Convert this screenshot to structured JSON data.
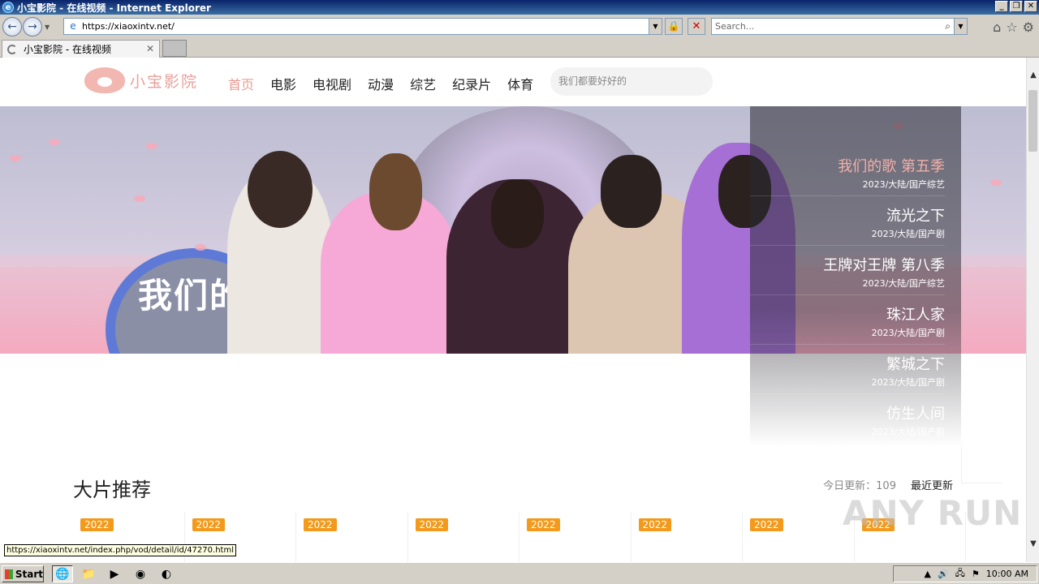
{
  "window": {
    "title": "小宝影院 - 在线视频 - Internet Explorer",
    "minimize": "_",
    "restore": "❐",
    "close": "✕"
  },
  "browser": {
    "address": "https://xiaoxintv.net/",
    "search_placeholder": "Search...",
    "tab_title": "小宝影院 - 在线视频",
    "tab_close": "✕",
    "status_link": "https://xiaoxintv.net/index.php/vod/detail/id/47270.html"
  },
  "site": {
    "logo_text": "小宝影院",
    "nav": [
      "首页",
      "电影",
      "电视剧",
      "动漫",
      "综艺",
      "纪录片",
      "体育"
    ],
    "search_placeholder": "我们都要好好的",
    "banner_emblem_text": "我们的"
  },
  "side_list": [
    {
      "title": "我们的歌 第五季",
      "meta": "2023/大陆/国产综艺"
    },
    {
      "title": "流光之下",
      "meta": "2023/大陆/国产剧"
    },
    {
      "title": "王牌对王牌 第八季",
      "meta": "2023/大陆/国产综艺"
    },
    {
      "title": "珠江人家",
      "meta": "2023/大陆/国产剧"
    },
    {
      "title": "繁城之下",
      "meta": "2023/大陆/国产剧"
    },
    {
      "title": "仿生人间",
      "meta": "2023/大陆/国产剧"
    }
  ],
  "section": {
    "title": "大片推荐",
    "today_label": "今日更新：",
    "today_count": "109",
    "latest": "最近更新",
    "badges": [
      "2022",
      "2022",
      "2022",
      "2022",
      "2022",
      "2022",
      "2022",
      "2022"
    ]
  },
  "watermark": "ANY RUN",
  "taskbar": {
    "start": "Start",
    "clock": "10:00 AM"
  },
  "colors": {
    "accent": "#e89c92",
    "badge": "#f39a1c"
  }
}
